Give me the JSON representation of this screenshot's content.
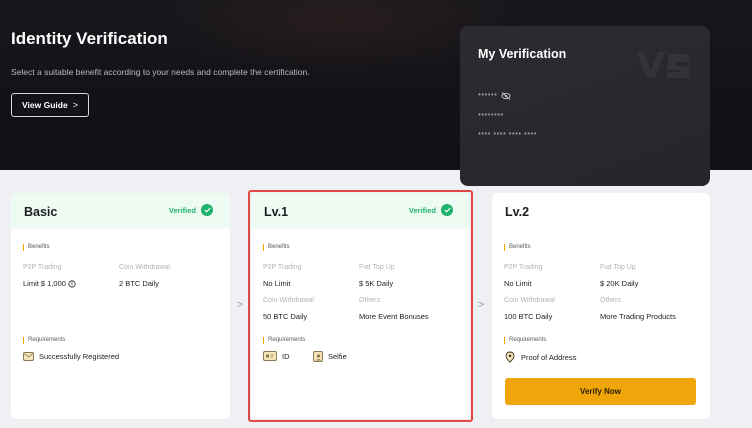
{
  "header": {
    "title": "Identity Verification",
    "subtitle": "Select a suitable benefit according to your needs and complete the certification.",
    "guide_button": "View Guide",
    "guide_chevron": ">"
  },
  "my_verification": {
    "title": "My Verification",
    "masked_line_1": "******",
    "masked_line_2": "********",
    "masked_line_3": "**** **** **** ****",
    "icons": [
      "eye-slash-icon",
      "logo-watermark"
    ]
  },
  "tiers": {
    "basic": {
      "name": "Basic",
      "status": "Verified",
      "benefits_label": "Benefits",
      "benefits": [
        {
          "label": "P2P Trading",
          "value": "Limit $ 1,000"
        },
        {
          "label": "Coin Withdrawal",
          "value": "2 BTC Daily"
        }
      ],
      "requirements_label": "Requirements",
      "requirements": [
        {
          "icon": "envelope-icon",
          "label": "Successfully Registered"
        }
      ]
    },
    "lv1": {
      "name": "Lv.1",
      "status": "Verified",
      "benefits_label": "Benefits",
      "benefits": [
        {
          "label": "P2P Trading",
          "value": "No Limit"
        },
        {
          "label": "Fiat Top Up",
          "value": "$ 5K Daily"
        },
        {
          "label": "Coin Withdrawal",
          "value": "50 BTC Daily"
        },
        {
          "label": "Others",
          "value": "More Event Bonuses"
        }
      ],
      "requirements_label": "Requirements",
      "requirements": [
        {
          "icon": "id-card-icon",
          "label": "ID"
        },
        {
          "icon": "selfie-icon",
          "label": "Selfie"
        }
      ]
    },
    "lv2": {
      "name": "Lv.2",
      "benefits_label": "Benefits",
      "benefits": [
        {
          "label": "P2P Trading",
          "value": "No Limit"
        },
        {
          "label": "Fiat Top Up",
          "value": "$ 20K Daily"
        },
        {
          "label": "Coin Withdrawal",
          "value": "100 BTC Daily"
        },
        {
          "label": "Others",
          "value": "More Trading Products"
        }
      ],
      "requirements_label": "Requirements",
      "requirements": [
        {
          "icon": "location-pin-icon",
          "label": "Proof of Address"
        }
      ],
      "action_button": "Verify Now"
    }
  },
  "arrows": [
    ">",
    ">"
  ],
  "colors": {
    "accent": "#f0a50a",
    "verified": "#20b26c",
    "highlight": "#e04848",
    "header_bg": "#121217"
  }
}
